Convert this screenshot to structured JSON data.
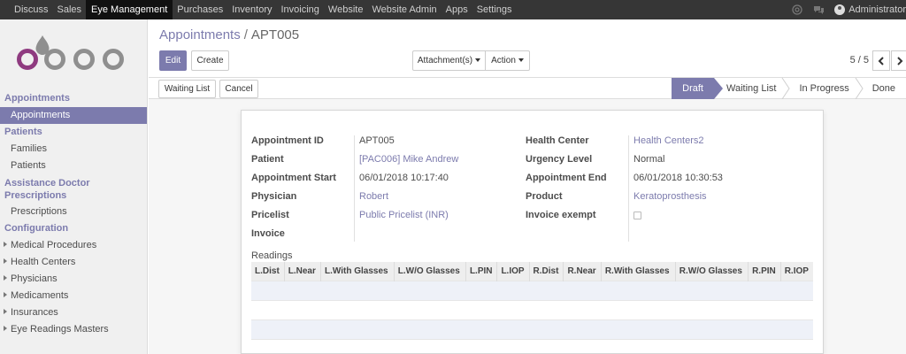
{
  "topbar": {
    "menu": [
      "Discuss",
      "Sales",
      "Eye Management",
      "Purchases",
      "Inventory",
      "Invoicing",
      "Website",
      "Website Admin",
      "Apps",
      "Settings"
    ],
    "active": "Eye Management",
    "user": "Administrator"
  },
  "sidebar": {
    "sections": [
      {
        "title": "Appointments",
        "items": [
          {
            "label": "Appointments",
            "active": true
          }
        ]
      },
      {
        "title": "Patients",
        "items": [
          {
            "label": "Families"
          },
          {
            "label": "Patients"
          }
        ]
      },
      {
        "title": "Assistance Doctor Prescriptions",
        "title_lines": [
          "Assistance Doctor",
          "Prescriptions"
        ],
        "items": [
          {
            "label": "Prescriptions"
          }
        ]
      },
      {
        "title": "Configuration",
        "items": [
          {
            "label": "Medical Procedures",
            "expandable": true
          },
          {
            "label": "Health Centers",
            "expandable": true
          },
          {
            "label": "Physicians",
            "expandable": true
          },
          {
            "label": "Medicaments",
            "expandable": true
          },
          {
            "label": "Insurances",
            "expandable": true
          },
          {
            "label": "Eye Readings Masters",
            "expandable": true
          }
        ]
      }
    ]
  },
  "breadcrumb": {
    "parent": "Appointments",
    "separator": "/",
    "current": "APT005"
  },
  "toolbar": {
    "edit": "Edit",
    "create": "Create",
    "attachments": "Attachment(s)",
    "action": "Action"
  },
  "pager": {
    "text": "5 / 5"
  },
  "statusbar": {
    "buttons": {
      "waiting_list": "Waiting List",
      "cancel": "Cancel"
    },
    "stages": [
      "Draft",
      "Waiting List",
      "In Progress",
      "Done"
    ],
    "current_stage": "Draft"
  },
  "form": {
    "left": [
      {
        "label": "Appointment ID",
        "value": "APT005",
        "link": false
      },
      {
        "label": "Patient",
        "value": "[PAC006] Mike Andrew",
        "link": true
      },
      {
        "label": "Appointment Start",
        "value": "06/01/2018 10:17:40",
        "link": false
      },
      {
        "label": "Physician",
        "value": "Robert",
        "link": true
      },
      {
        "label": "Pricelist",
        "value": "Public Pricelist (INR)",
        "link": true
      },
      {
        "label": "Invoice",
        "value": "",
        "link": false
      }
    ],
    "right": [
      {
        "label": "Health Center",
        "value": "Health Centers2",
        "link": true
      },
      {
        "label": "Urgency Level",
        "value": "Normal",
        "link": false
      },
      {
        "label": "Appointment End",
        "value": "06/01/2018 10:30:53",
        "link": false
      },
      {
        "label": "Product",
        "value": "Keratoprosthesis",
        "link": true
      },
      {
        "label": "Invoice exempt",
        "value": "",
        "checkbox": true,
        "checked": false
      }
    ]
  },
  "readings": {
    "title": "Readings",
    "columns": [
      "L.Dist",
      "L.Near",
      "L.With Glasses",
      "L.W/O Glasses",
      "L.PIN",
      "L.IOP",
      "R.Dist",
      "R.Near",
      "R.With Glasses",
      "R.W/O Glasses",
      "R.PIN",
      "R.IOP"
    ],
    "rows": 4
  },
  "colors": {
    "accent": "#7c7bad",
    "topbar": "#363636",
    "logo_purple": "#8f3b80",
    "logo_grey": "#8f8f8f"
  }
}
